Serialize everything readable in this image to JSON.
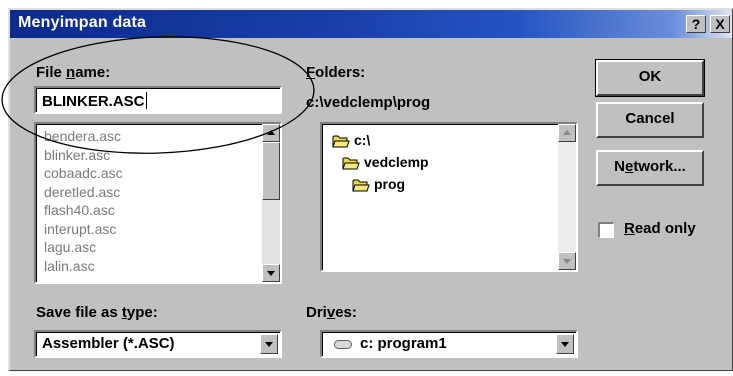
{
  "dialog": {
    "title": "Menyimpan data",
    "help_glyph": "?",
    "close_glyph": "X"
  },
  "file_name": {
    "label_prefix": "File ",
    "label_underlined": "n",
    "label_suffix": "ame:",
    "value": "BLINKER.ASC"
  },
  "file_list": {
    "items": [
      "bendera.asc",
      "blinker.asc",
      "cobaadc.asc",
      "deretled.asc",
      "flash40.asc",
      "interupt.asc",
      "lagu.asc",
      "lalin.asc"
    ]
  },
  "folders": {
    "label_underlined": "F",
    "label_suffix": "olders:",
    "current_path": "c:\\vedclemp\\prog",
    "tree": [
      {
        "label": "c:\\",
        "icon": "open-folder-icon"
      },
      {
        "label": "vedclemp",
        "icon": "open-folder-icon"
      },
      {
        "label": "prog",
        "icon": "open-folder-icon"
      }
    ]
  },
  "buttons": {
    "ok": "OK",
    "cancel": "Cancel",
    "network_prefix": "N",
    "network_underlined": "e",
    "network_suffix": "twork..."
  },
  "read_only": {
    "label_underlined": "R",
    "label_suffix": "ead only",
    "checked": false
  },
  "save_type": {
    "label_prefix": "Save file as ",
    "label_underlined": "t",
    "label_suffix": "ype:",
    "selected": "Assembler (*.ASC)"
  },
  "drives": {
    "label_prefix": "Dri",
    "label_underlined": "v",
    "label_suffix": "es:",
    "selected": "c: program1",
    "icon": "hard-drive-icon"
  },
  "colors": {
    "dialog_face": "#c0c0c0",
    "titlebar_start": "#0a2a8c",
    "titlebar_end": "#dfe6f5",
    "folder_yellow": "#e8d84a"
  }
}
